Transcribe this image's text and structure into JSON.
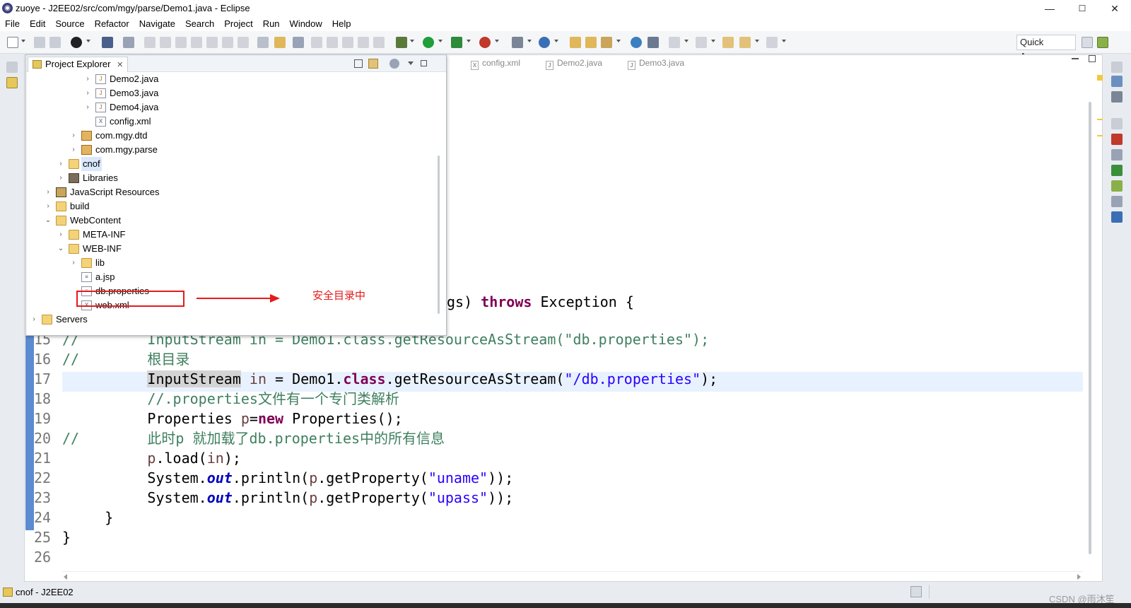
{
  "window": {
    "title": "zuoye - J2EE02/src/com/mgy/parse/Demo1.java - Eclipse",
    "controls": {
      "minimize": "—",
      "maximize": "☐",
      "close": "✕"
    }
  },
  "menu": [
    "File",
    "Edit",
    "Source",
    "Refactor",
    "Navigate",
    "Search",
    "Project",
    "Run",
    "Window",
    "Help"
  ],
  "toolbar": {
    "quick_access": "Quick Access"
  },
  "editor_tabs": [
    "config.xml",
    "Demo2.java",
    "Demo3.java"
  ],
  "project_explorer": {
    "title": "Project Explorer",
    "close": "✕",
    "tree": [
      {
        "label": "Demo2.java",
        "icon": "java-file-icon",
        "chevron": "›"
      },
      {
        "label": "Demo3.java",
        "icon": "java-file-icon",
        "chevron": "›"
      },
      {
        "label": "Demo4.java",
        "icon": "java-file-icon",
        "chevron": "›"
      },
      {
        "label": "config.xml",
        "icon": "xml-file-icon",
        "chevron": ""
      },
      {
        "label": "com.mgy.dtd",
        "icon": "package-icon",
        "chevron": "›"
      },
      {
        "label": "com.mgy.parse",
        "icon": "package-icon",
        "chevron": "›"
      },
      {
        "label": "cnof",
        "icon": "folder-icon",
        "chevron": "›"
      },
      {
        "label": "Libraries",
        "icon": "library-icon",
        "chevron": "›"
      },
      {
        "label": "JavaScript Resources",
        "icon": "js-resources-icon",
        "chevron": "›"
      },
      {
        "label": "build",
        "icon": "folder-icon",
        "chevron": "›"
      },
      {
        "label": "WebContent",
        "icon": "folder-icon",
        "chevron": "⌄"
      },
      {
        "label": "META-INF",
        "icon": "folder-icon",
        "chevron": "›"
      },
      {
        "label": "WEB-INF",
        "icon": "folder-icon",
        "chevron": "⌄"
      },
      {
        "label": "lib",
        "icon": "folder-icon",
        "chevron": "›"
      },
      {
        "label": "a.jsp",
        "icon": "jsp-file-icon",
        "chevron": ""
      },
      {
        "label": "db.properties",
        "icon": "properties-file-icon",
        "chevron": ""
      },
      {
        "label": "web.xml",
        "icon": "xml-file-icon",
        "chevron": ""
      },
      {
        "label": "Servers",
        "icon": "folder-icon",
        "chevron": "›"
      }
    ]
  },
  "annotation": {
    "text": "安全目录中",
    "color": "#e41b1b"
  },
  "code": {
    "partial_line": {
      "t1": "gs)",
      "t2": "throws",
      "t3": "Exception {"
    },
    "line_numbers": [
      "15",
      "16",
      "17",
      "18",
      "19",
      "20",
      "21",
      "22",
      "23",
      "24",
      "25",
      "26"
    ],
    "l15": {
      "c": "//",
      "body": "InputStream in = Demo1.class.getResourceAsStream(\"db.properties\");"
    },
    "l16": {
      "c": "//",
      "body": "根目录"
    },
    "l17": {
      "a": "InputStream",
      "b": " ",
      "c": "in",
      "d": " = Demo1.",
      "e": "class",
      "f": ".getResourceAsStream(",
      "g": "\"/db.properties\"",
      "h": ");"
    },
    "l18": {
      "c": "//.properties文件有一个专门类解析"
    },
    "l19": {
      "a": "Properties ",
      "b": "p",
      "c": "=",
      "d": "new",
      "e": " Properties();"
    },
    "l20": {
      "c": "//",
      "body": "此时p 就加载了db.properties中的所有信息"
    },
    "l21": {
      "a": "p",
      "b": ".load(",
      "c": "in",
      "d": ");"
    },
    "l22": {
      "a": "System.",
      "b": "out",
      "c": ".println(",
      "d": "p",
      "e": ".getProperty(",
      "f": "\"uname\"",
      "g": "));"
    },
    "l23": {
      "a": "System.",
      "b": "out",
      "c": ".println(",
      "d": "p",
      "e": ".getProperty(",
      "f": "\"upass\"",
      "g": "));"
    },
    "l24": {
      "a": "}"
    },
    "l25": {
      "a": "}"
    }
  },
  "status": {
    "selection": "cnof - J2EE02"
  },
  "watermark": "CSDN @雨沐笙"
}
